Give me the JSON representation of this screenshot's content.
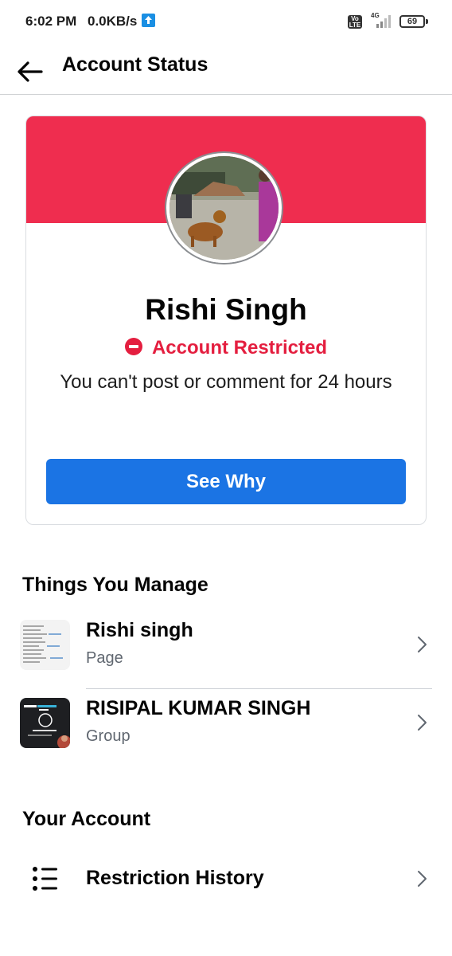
{
  "status_bar": {
    "time": "6:02 PM",
    "speed": "0.0KB/s",
    "volte": "Vo LTE",
    "network": "4G",
    "battery": "69"
  },
  "header": {
    "title": "Account Status",
    "back_icon": "arrow-left-icon"
  },
  "profile": {
    "name": "Rishi Singh",
    "status": "Account Restricted",
    "status_icon": "restricted-icon",
    "description": "You can't post or comment for 24 hours",
    "button_label": "See Why",
    "colors": {
      "banner": "#ef2d4f",
      "status": "#e41e3f",
      "button": "#1b74e4"
    }
  },
  "things_you_manage": {
    "title": "Things You Manage",
    "items": [
      {
        "title": "Rishi singh",
        "subtitle": "Page",
        "icon": "chevron-right-icon"
      },
      {
        "title": "RISIPAL KUMAR SINGH",
        "subtitle": "Group",
        "icon": "chevron-right-icon"
      }
    ]
  },
  "your_account": {
    "title": "Your Account",
    "items": [
      {
        "label": "Restriction History",
        "icon": "list-icon"
      }
    ]
  }
}
